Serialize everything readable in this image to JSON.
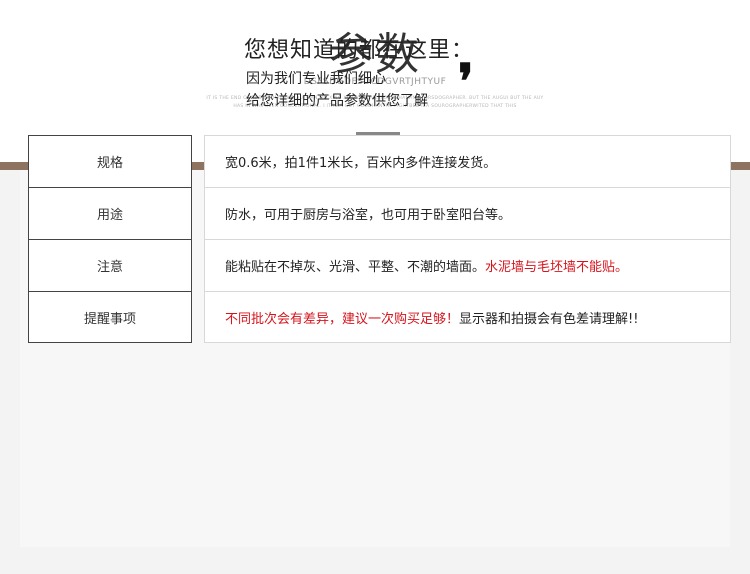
{
  "header": {
    "title": "参数",
    "subtitle": "DSFSDGDFSDCDGVRTJHTYUF",
    "small_line_1": "IT IS THE END OF THE SPRING AND AUTUMN LIU XING XI VIANGE VESTORODHANAN STORSDOGRAPHER. BUT THE AUGUI BUT THE AUY",
    "small_line_2": "HAS IN WAS BEEN CONCENTIONAL. I IT IS A GOT COODHANTHE FIGHTBED IEA SOUROGRAPHERWITED THAT THIS"
  },
  "intro": {
    "heading": "您想知道的都在这里：",
    "line1": "因为我们专业我们细心",
    "line2": "给您详细的产品参数供您了解",
    "mark": "❜"
  },
  "specs": {
    "rows": [
      {
        "label": "规格",
        "value": "宽0.6米，拍1件1米长，百米内多件连接发货。",
        "highlight": ""
      },
      {
        "label": "用途",
        "value": "防水，可用于厨房与浴室，也可用于卧室阳台等。",
        "highlight": ""
      },
      {
        "label": "注意",
        "value": "能粘贴在不掉灰、光滑、平整、不潮的墙面。",
        "highlight": "水泥墙与毛坯墙不能贴。"
      },
      {
        "label": "提醒事项",
        "value_red": "不同批次会有差异，建议一次购买足够！",
        "value": "显示器和拍摄会有色差请理解!!"
      }
    ]
  },
  "colors": {
    "band": "#8f7361",
    "highlight": "#d5141c"
  }
}
